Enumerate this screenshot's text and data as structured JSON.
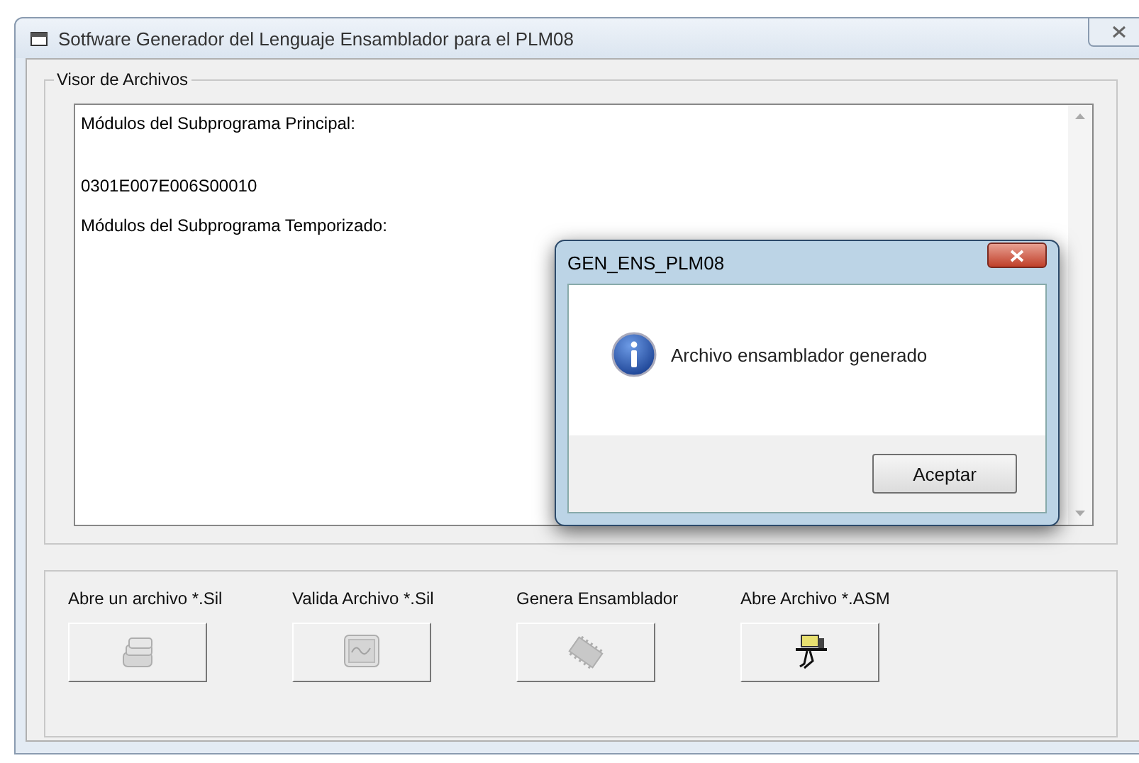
{
  "window": {
    "title": "Sotfware Generador del Lenguaje Ensamblador para el PLM08"
  },
  "viewer": {
    "label": "Visor de Archivos",
    "lines": [
      {
        "text": "Módulos del Subprograma Principal:"
      },
      {
        "text": "0301E007E006S00010"
      },
      {
        "text": "Módulos del Subprograma Temporizado:"
      }
    ]
  },
  "actions": [
    {
      "label": "Abre un archivo *.Sil",
      "kind": "open",
      "disabled": true
    },
    {
      "label": "Valida Archivo *.Sil",
      "kind": "validate",
      "disabled": true
    },
    {
      "label": "Genera Ensamblador",
      "kind": "chip",
      "disabled": true
    },
    {
      "label": "Abre Archivo *.ASM",
      "kind": "asm",
      "disabled": false
    }
  ],
  "dialog": {
    "title": "GEN_ENS_PLM08",
    "message": "Archivo ensamblador generado",
    "button": "Aceptar"
  }
}
